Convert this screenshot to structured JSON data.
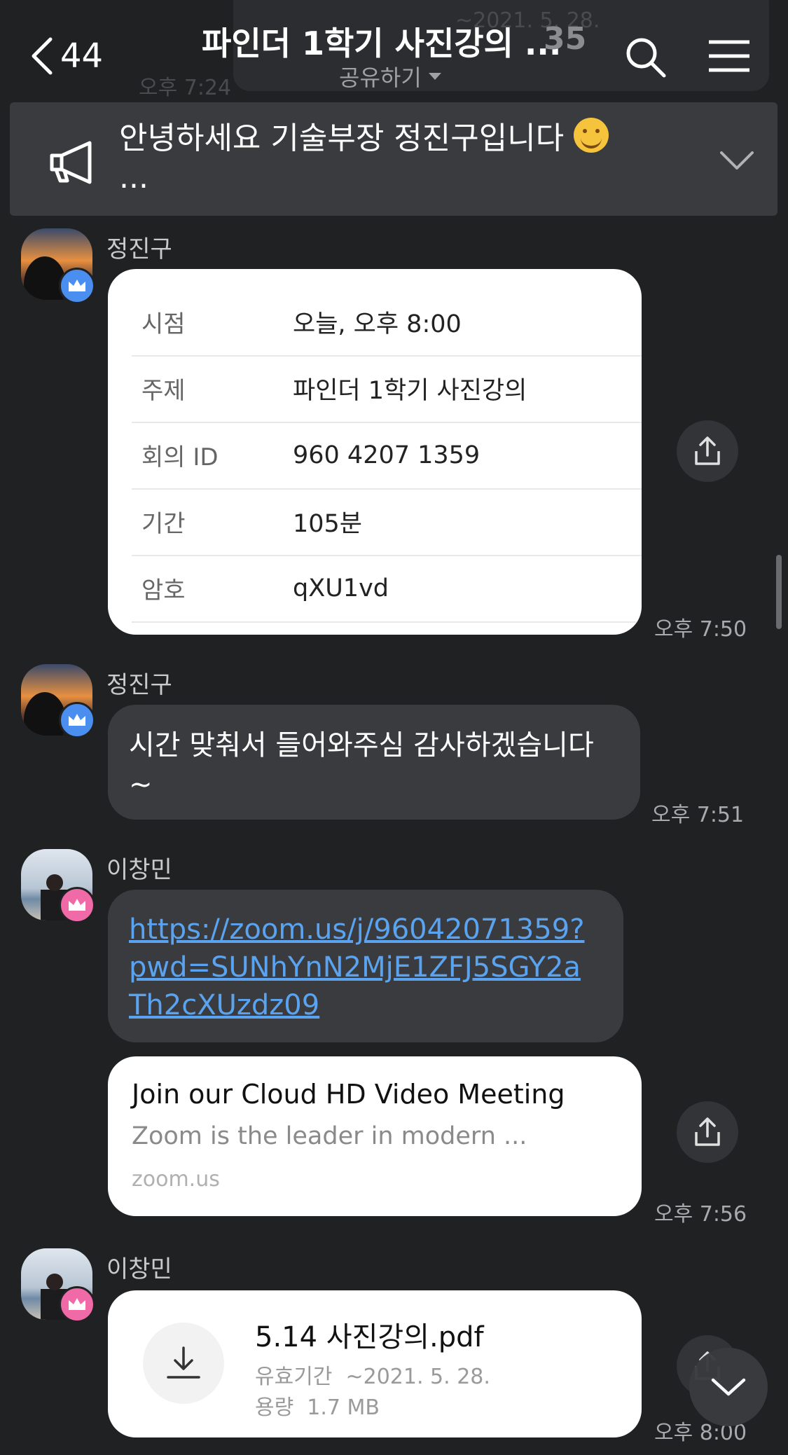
{
  "header": {
    "back_count": "44",
    "title": "파인더 1학기 사진강의 ...",
    "member_count": "35",
    "subtitle": "공유하기",
    "ghost_time": "오후 7:24",
    "ghost_date": "~2021. 5. 28."
  },
  "notice": {
    "line1": "안녕하세요 기술부장 정진구입니다",
    "line2": "..."
  },
  "messages": [
    {
      "sender": "정진구",
      "zoom_info": [
        {
          "label": "시점",
          "value": "오늘, 오후 8:00"
        },
        {
          "label": "주제",
          "value": "파인더 1학기 사진강의"
        },
        {
          "label": "회의 ID",
          "value": "960 4207 1359"
        },
        {
          "label": "기간",
          "value": "105분"
        },
        {
          "label": "암호",
          "value": "qXU1vd"
        }
      ],
      "time": "오후 7:50"
    },
    {
      "sender": "정진구",
      "text_line1": "시간 맞춰서 들어와주심 감사하겠습니다",
      "text_line2": "~",
      "time": "오후 7:51"
    },
    {
      "sender": "이창민",
      "link_lines": [
        "https://zoom.us/j/96042071359?",
        "pwd=SUNhYnN2MjE1ZFJ5SGY2a",
        "Th2cXUzdz09"
      ],
      "preview_title": "Join our Cloud HD Video Meeting",
      "preview_desc": "Zoom is the leader in modern ...",
      "preview_domain": "zoom.us",
      "time": "오후 7:56"
    },
    {
      "sender": "이창민",
      "file_name": "5.14 사진강의.pdf",
      "expiry_label": "유효기간",
      "expiry_value": "~2021. 5. 28.",
      "size_label": "용량",
      "size_value": "1.7 MB",
      "time": "오후 8:00"
    }
  ],
  "colors": {
    "background": "#202123",
    "bubble_dark": "#3a3b3e",
    "link": "#5aa3f0",
    "badge_blue": "#4a8ef0",
    "badge_pink": "#f06aa8"
  }
}
